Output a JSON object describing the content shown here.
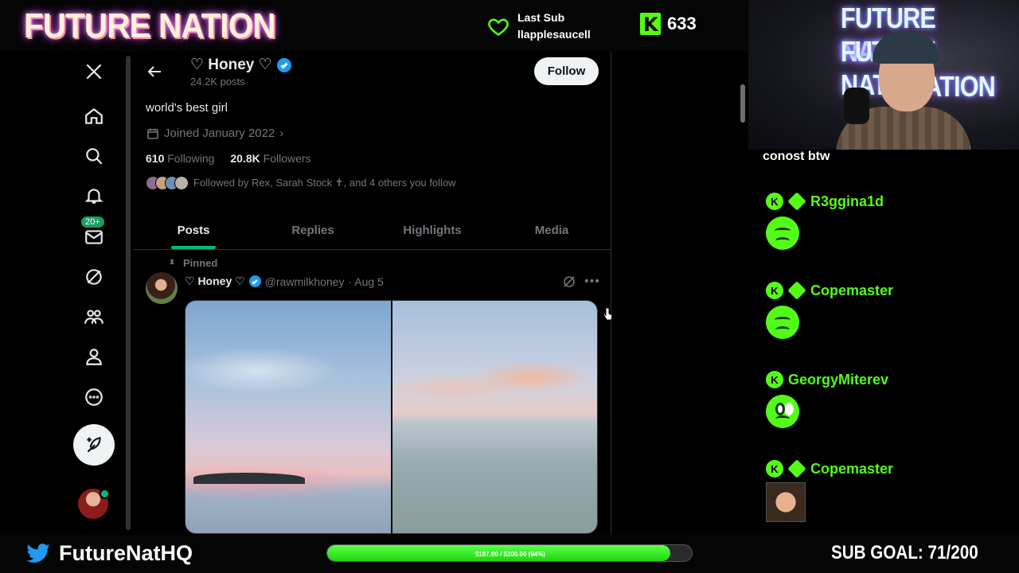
{
  "overlay": {
    "brand": "FUTURE NATION",
    "last_sub": {
      "label": "Last Sub",
      "name": "llapplesaucell"
    },
    "kick_count": "633",
    "webcam_neon_lines": [
      "FUTURE NATION",
      "FUTURE NATION",
      "NATION"
    ],
    "twitter_handle": "FutureNatHQ",
    "goal_bar_text": "$187.00 / $200.00 (94%)",
    "goal_progress": 0.94,
    "sub_goal": "SUB GOAL: 71/200",
    "colors": {
      "kick_green": "#53fc18",
      "twitter_blue": "#1d9bf0"
    }
  },
  "nav": {
    "items": [
      "x-logo",
      "home",
      "search",
      "notifications",
      "messages",
      "grok",
      "communities",
      "profile",
      "more"
    ],
    "messages_badge": "20+"
  },
  "profile": {
    "name": "♡ Honey ♡",
    "posts_count": "24.2K posts",
    "follow_label": "Follow",
    "bio": "world's best girl",
    "joined": "Joined January 2022",
    "following_count": "610",
    "following_label": "Following",
    "followers_count": "20.8K",
    "followers_label": "Followers",
    "followed_by": "Followed by Rex, Sarah Stock ✝, and 4 others you follow"
  },
  "tabs": [
    "Posts",
    "Replies",
    "Highlights",
    "Media"
  ],
  "post": {
    "pinned_label": "Pinned",
    "author": "♡ Honey ♡",
    "handle": "@rawmilkhoney",
    "date": "· Aug 5"
  },
  "chat": {
    "top_fragment": "conost btw",
    "messages": [
      {
        "user": "R3ggina1d"
      },
      {
        "user": "Copemaster"
      },
      {
        "user": "GeorgyMiterev"
      },
      {
        "user": "Copemaster"
      }
    ]
  }
}
